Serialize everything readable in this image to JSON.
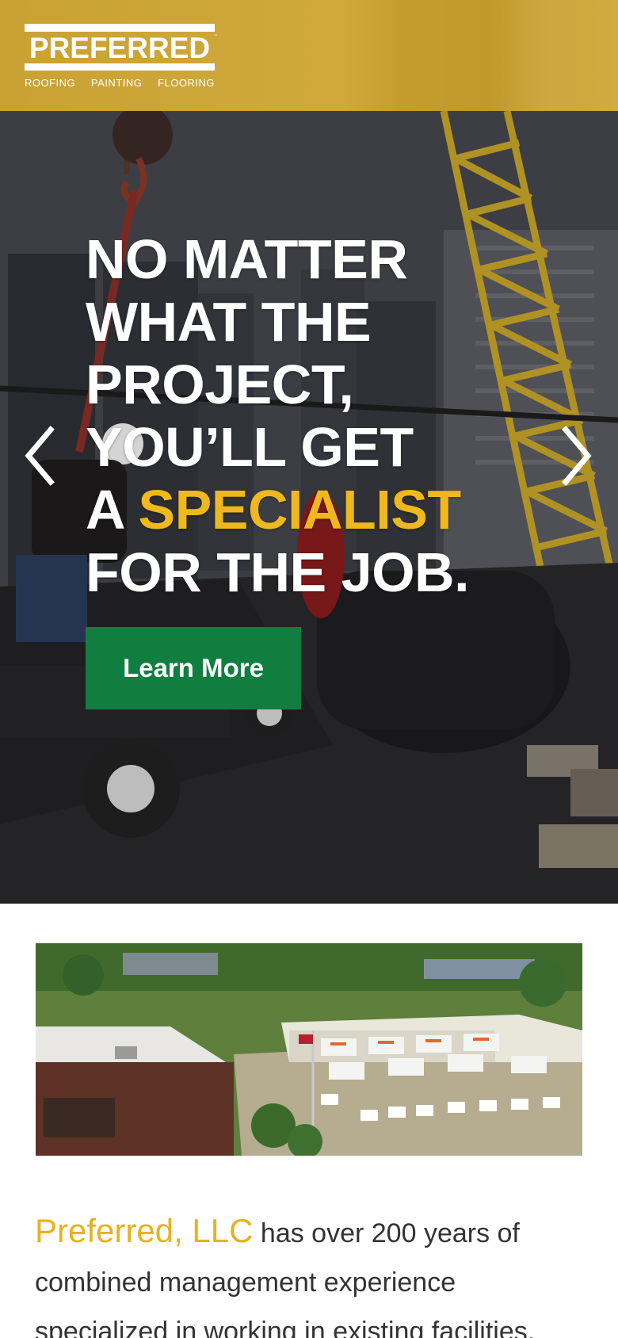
{
  "header": {
    "logo_word": "PREFERRED",
    "logo_tm": "™",
    "logo_services": [
      "ROOFING",
      "PAINTING",
      "FLOORING"
    ]
  },
  "hero": {
    "headline": {
      "line1": "NO MATTER",
      "line2": "WHAT THE",
      "line3": "PROJECT,",
      "line4": "YOU’LL GET",
      "line5_prefix": "A ",
      "line5_accent": "SPECIALIST",
      "line6": "FOR THE JOB."
    },
    "cta_label": "Learn More",
    "prev_icon": "chevron-left-icon",
    "next_icon": "chevron-right-icon"
  },
  "about": {
    "brand": "Preferred, LLC",
    "text": " has over 200 years of combined management experience specialized in working in existing facilities."
  },
  "colors": {
    "header_gold": "#c9a233",
    "accent_yellow": "#efb81e",
    "cta_green": "#0f7e3f",
    "brand_text": "#e7b21b",
    "body_text": "#333333"
  }
}
